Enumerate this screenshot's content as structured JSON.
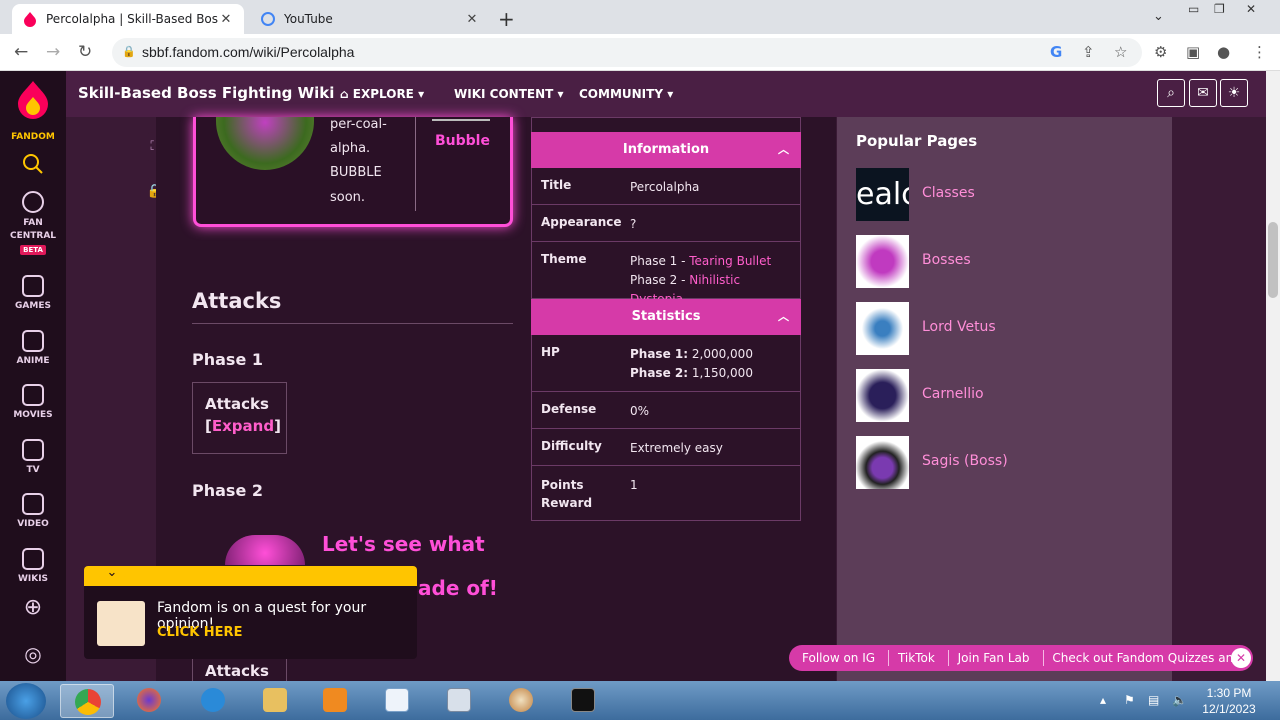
{
  "browser": {
    "tabs": [
      {
        "title": "Percolalpha | Skill-Based Boss Fig",
        "active": true
      },
      {
        "title": "YouTube",
        "active": false
      }
    ],
    "url": "sbbf.fandom.com/wiki/Percolalpha"
  },
  "rail": {
    "brand": "FANDOM",
    "items": [
      {
        "label": "FAN CENTRAL",
        "icon": "rocket-icon"
      },
      {
        "label": "GAMES",
        "icon": "gamepad-icon"
      },
      {
        "label": "ANIME",
        "icon": "anime-icon"
      },
      {
        "label": "MOVIES",
        "icon": "movies-icon"
      },
      {
        "label": "TV",
        "icon": "tv-icon"
      },
      {
        "label": "VIDEO",
        "icon": "video-icon"
      },
      {
        "label": "WIKIS",
        "icon": "wikis-icon"
      }
    ],
    "beta": "BETA"
  },
  "wiki": {
    "title": "Skill-Based Boss Fighting Wiki",
    "nav": [
      "EXPLORE",
      "WIKI CONTENT",
      "COMMUNITY"
    ]
  },
  "card": {
    "quote_lines": [
      "per-coal-",
      "alpha.",
      "BUBBLE",
      "soon."
    ],
    "bubble": "Bubble"
  },
  "article": {
    "heading": "Attacks",
    "phase1": "Phase 1",
    "phase2": "Phase 2",
    "attacks_label": "Attacks",
    "expand_open": "[",
    "expand": "Expand",
    "expand_close": "]",
    "quote_line1": "Let's see what",
    "quote_line2": "ade of!"
  },
  "infobox": {
    "section1": "Information",
    "rows1": [
      {
        "k": "Title",
        "v": "Percolalpha"
      },
      {
        "k": "Appearance",
        "v": "?"
      }
    ],
    "theme_label": "Theme",
    "theme_p1_prefix": "Phase 1 - ",
    "theme_p1_link": "Tearing Bullet",
    "theme_p2_prefix": "Phase 2 - ",
    "theme_p2_link": "Nihilistic Dystopia",
    "section2": "Statistics",
    "hp_label": "HP",
    "hp_p1_label": "Phase 1:",
    "hp_p1_value": "2,000,000",
    "hp_p2_label": "Phase 2:",
    "hp_p2_value": "1,150,000",
    "rows2": [
      {
        "k": "Defense",
        "v": "0%"
      },
      {
        "k": "Difficulty",
        "v": "Extremely easy"
      }
    ],
    "points_label_1": "Points",
    "points_label_2": "Reward",
    "points_value": "1"
  },
  "popular": {
    "title": "Popular Pages",
    "items": [
      "Classes",
      "Bosses",
      "Lord Vetus",
      "Carnellio",
      "Sagis (Boss)"
    ],
    "classes_thumb_text": "ealc"
  },
  "quest": {
    "text": "Fandom is on a quest for your opinion!",
    "cta": "CLICK HERE"
  },
  "social": [
    "Follow on IG",
    "TikTok",
    "Join Fan Lab",
    "Check out Fandom Quizzes and cha"
  ],
  "taskbar": {
    "time": "1:30 PM",
    "date": "12/1/2023"
  },
  "colors": {
    "accent": "#d63aa8",
    "link": "#ff5ecb",
    "quest_yellow": "#ffc500"
  }
}
